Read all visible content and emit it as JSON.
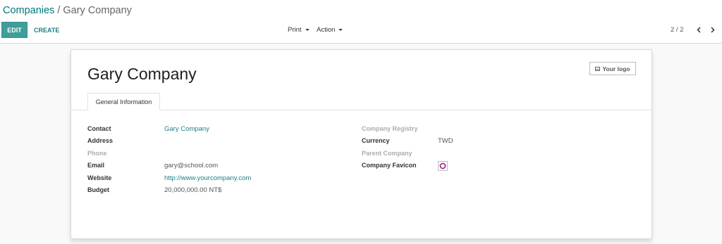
{
  "breadcrumb": {
    "parent": "Companies",
    "separator": "/",
    "current": "Gary Company"
  },
  "toolbar": {
    "edit_label": "EDIT",
    "create_label": "CREATE",
    "print_label": "Print",
    "action_label": "Action"
  },
  "pager": {
    "value": "2 / 2",
    "prev_icon": "chevron-left-icon",
    "next_icon": "chevron-right-icon"
  },
  "form": {
    "company_name": "Gary Company",
    "logo_button": "Your logo",
    "tab_label": "General Information",
    "left_fields": [
      {
        "label": "Contact",
        "value": "Gary Company"
      },
      {
        "label": "Address",
        "value": ""
      },
      {
        "label": "Phone",
        "value": ""
      },
      {
        "label": "Email",
        "value": "gary@school.com"
      },
      {
        "label": "Website",
        "value": "http://www.yourcompany.com"
      },
      {
        "label": "Budget",
        "value": "20,000,000.00 NT$"
      }
    ],
    "right_fields": [
      {
        "label": "Company Registry",
        "value": ""
      },
      {
        "label": "Currency",
        "value": "TWD"
      },
      {
        "label": "Parent Company",
        "value": ""
      },
      {
        "label": "Company Favicon",
        "value": ""
      }
    ]
  },
  "colors": {
    "primary": "#3f9e99",
    "link": "#1f7f86",
    "favicon": "#a0358f"
  }
}
